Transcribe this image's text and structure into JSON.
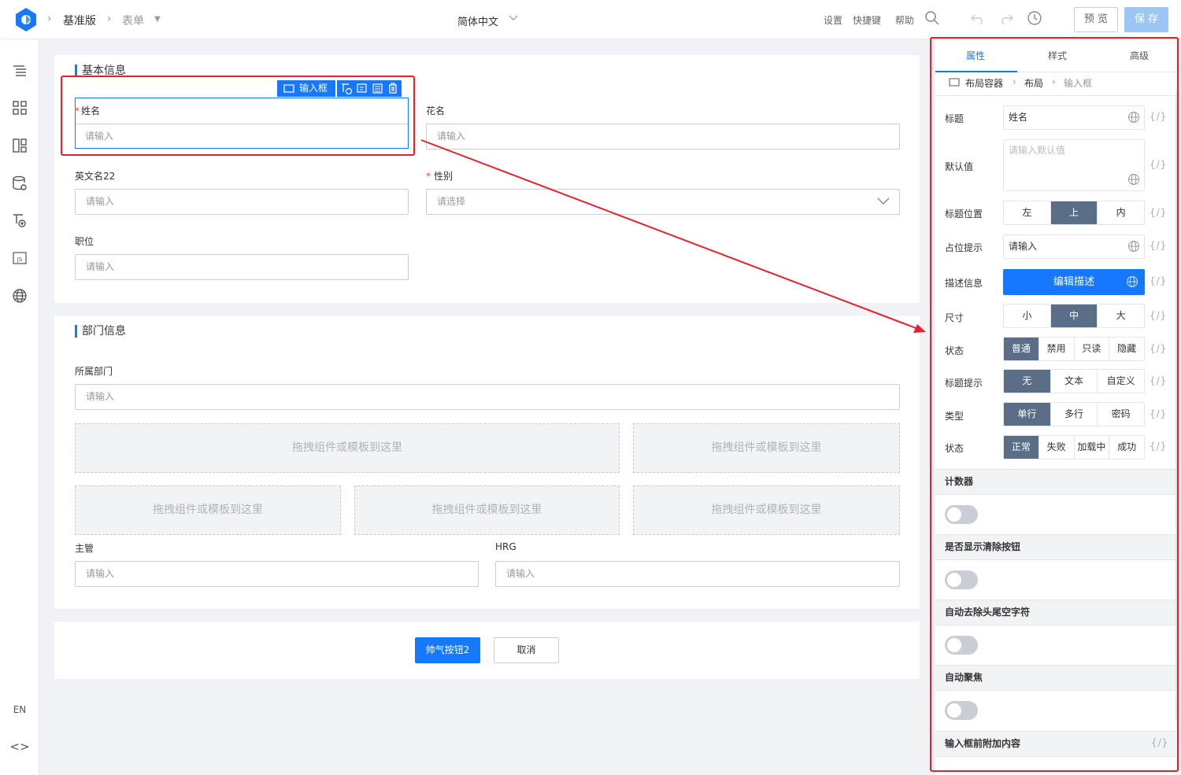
{
  "topbar": {
    "breadcrumb_root": "基准版",
    "breadcrumb_page": "表单",
    "language": "简体中文",
    "links": [
      "设置",
      "快捷键",
      "帮助"
    ],
    "preview_label": "预 览",
    "save_label": "保 存"
  },
  "leftbar": {
    "icons": [
      "outline-icon",
      "components-icon",
      "layout-icon",
      "datasource-icon",
      "flow-icon",
      "js-icon",
      "globe-icon"
    ],
    "lang_label": "EN",
    "code_label": "<>"
  },
  "form": {
    "section1_title": "基本信息",
    "section2_title": "部门信息",
    "selected_tag": "输入框",
    "fields": {
      "name": {
        "label": "姓名",
        "placeholder": "请输入",
        "required": true
      },
      "nickname": {
        "label": "花名",
        "placeholder": "请输入"
      },
      "english_name": {
        "label": "英文名22",
        "placeholder": "请输入"
      },
      "gender": {
        "label": "性别",
        "placeholder": "请选择",
        "required": true
      },
      "position": {
        "label": "职位",
        "placeholder": "请输入"
      },
      "department": {
        "label": "所属部门",
        "placeholder": "请输入"
      },
      "manager": {
        "label": "主管",
        "placeholder": "请输入"
      },
      "hrg": {
        "label": "HRG",
        "placeholder": "请输入"
      }
    },
    "drop_placeholder": "拖拽组件或模板到这里",
    "submit_label": "帅气按钮2",
    "cancel_label": "取消"
  },
  "panel": {
    "tabs": [
      "属性",
      "样式",
      "高级"
    ],
    "active_tab": "属性",
    "crumbs": [
      "布局容器",
      "布局",
      "输入框"
    ],
    "title_label": "标题",
    "title_value": "姓名",
    "default_label": "默认值",
    "default_placeholder": "请输入默认值",
    "title_pos_label": "标题位置",
    "title_pos_options": [
      "左",
      "上",
      "内"
    ],
    "placeholder_label": "占位提示",
    "placeholder_value": "请输入",
    "desc_label": "描述信息",
    "desc_button": "编辑描述",
    "size_label": "尺寸",
    "size_options": [
      "小",
      "中",
      "大"
    ],
    "state_label": "状态",
    "state_options": [
      "普通",
      "禁用",
      "只读",
      "隐藏"
    ],
    "title_tip_label": "标题提示",
    "title_tip_options": [
      "无",
      "文本",
      "自定义"
    ],
    "type_label": "类型",
    "type_options": [
      "单行",
      "多行",
      "密码"
    ],
    "status_label": "状态",
    "status_options": [
      "正常",
      "失败",
      "加载中",
      "成功"
    ],
    "fx_label": "{/}",
    "groups": [
      "计数器",
      "是否显示清除按钮",
      "自动去除头尾空字符",
      "自动聚焦",
      "输入框前附加内容"
    ]
  }
}
